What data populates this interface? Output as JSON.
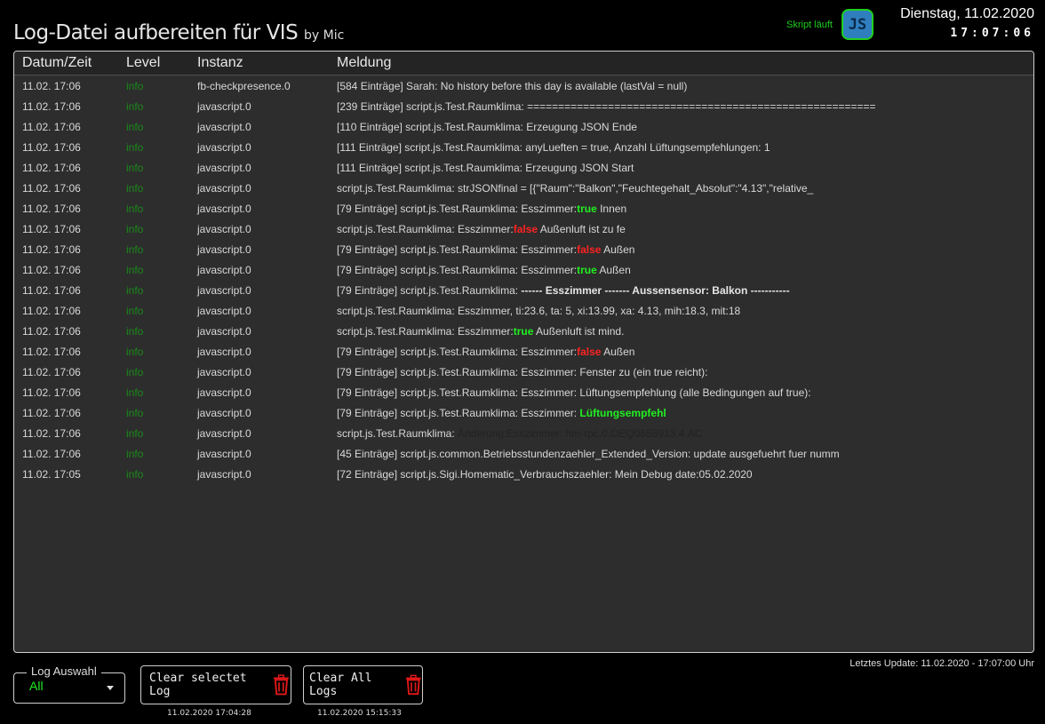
{
  "header": {
    "title": "Log-Datei aufbereiten für VIS",
    "byline": "by Mic",
    "status": "Skript läuft",
    "js_badge": "JS",
    "date": "Dienstag, 11.02.2020",
    "time": "17:07:06"
  },
  "table": {
    "columns": [
      "Datum/Zeit",
      "Level",
      "Instanz",
      "Meldung"
    ],
    "rows": [
      {
        "datetime": "11.02. 17:06",
        "level": "info",
        "instance": "fb-checkpresence.0",
        "msg": [
          {
            "t": "[584 Einträge] Sarah: No history before this day is available (lastVal = null)"
          }
        ]
      },
      {
        "datetime": "11.02. 17:06",
        "level": "info",
        "instance": "javascript.0",
        "msg": [
          {
            "t": "[239 Einträge] script.js.Test.Raumklima: ========================================================"
          }
        ]
      },
      {
        "datetime": "11.02. 17:06",
        "level": "info",
        "instance": "javascript.0",
        "msg": [
          {
            "t": "[110 Einträge] script.js.Test.Raumklima: Erzeugung JSON Ende"
          }
        ]
      },
      {
        "datetime": "11.02. 17:06",
        "level": "info",
        "instance": "javascript.0",
        "msg": [
          {
            "t": "[111 Einträge] script.js.Test.Raumklima: anyLueften = true, Anzahl Lüftungsempfehlungen: 1"
          }
        ]
      },
      {
        "datetime": "11.02. 17:06",
        "level": "info",
        "instance": "javascript.0",
        "msg": [
          {
            "t": "[111 Einträge] script.js.Test.Raumklima: Erzeugung JSON Start"
          }
        ]
      },
      {
        "datetime": "11.02. 17:06",
        "level": "info",
        "instance": "javascript.0",
        "msg": [
          {
            "t": "script.js.Test.Raumklima: strJSONfinal = [{\"Raum\":\"Balkon\",\"Feuchtegehalt_Absolut\":\"4.13\",\"relative_"
          }
        ]
      },
      {
        "datetime": "11.02. 17:06",
        "level": "info",
        "instance": "javascript.0",
        "msg": [
          {
            "t": "[79 Einträge] script.js.Test.Raumklima: Esszimmer:"
          },
          {
            "t": "true",
            "s": "t"
          },
          {
            "t": " Innen"
          }
        ]
      },
      {
        "datetime": "11.02. 17:06",
        "level": "info",
        "instance": "javascript.0",
        "msg": [
          {
            "t": "script.js.Test.Raumklima: Esszimmer:"
          },
          {
            "t": "false",
            "s": "f"
          },
          {
            "t": " Außenluft ist zu fe"
          }
        ]
      },
      {
        "datetime": "11.02. 17:06",
        "level": "info",
        "instance": "javascript.0",
        "msg": [
          {
            "t": "[79 Einträge] script.js.Test.Raumklima: Esszimmer:"
          },
          {
            "t": "false",
            "s": "f"
          },
          {
            "t": " Außen"
          }
        ]
      },
      {
        "datetime": "11.02. 17:06",
        "level": "info",
        "instance": "javascript.0",
        "msg": [
          {
            "t": "[79 Einträge] script.js.Test.Raumklima: Esszimmer:"
          },
          {
            "t": "true",
            "s": "t"
          },
          {
            "t": " Außen"
          }
        ]
      },
      {
        "datetime": "11.02. 17:06",
        "level": "info",
        "instance": "javascript.0",
        "msg": [
          {
            "t": "[79 Einträge] script.js.Test.Raumklima: "
          },
          {
            "t": "------ Esszimmer ------- Aussensensor: Balkon -----------",
            "s": "b"
          }
        ]
      },
      {
        "datetime": "11.02. 17:06",
        "level": "info",
        "instance": "javascript.0",
        "msg": [
          {
            "t": "script.js.Test.Raumklima: Esszimmer, ti:23.6, ta: 5, xi:13.99, xa: 4.13, mih:18.3, mit:18"
          }
        ]
      },
      {
        "datetime": "11.02. 17:06",
        "level": "info",
        "instance": "javascript.0",
        "msg": [
          {
            "t": "script.js.Test.Raumklima: Esszimmer:"
          },
          {
            "t": "true",
            "s": "t"
          },
          {
            "t": " Außenluft ist mind."
          }
        ]
      },
      {
        "datetime": "11.02. 17:06",
        "level": "info",
        "instance": "javascript.0",
        "msg": [
          {
            "t": "[79 Einträge] script.js.Test.Raumklima: Esszimmer:"
          },
          {
            "t": "false",
            "s": "f"
          },
          {
            "t": " Außen"
          }
        ]
      },
      {
        "datetime": "11.02. 17:06",
        "level": "info",
        "instance": "javascript.0",
        "msg": [
          {
            "t": "[79 Einträge] script.js.Test.Raumklima: Esszimmer: Fenster zu (ein true reicht):"
          }
        ]
      },
      {
        "datetime": "11.02. 17:06",
        "level": "info",
        "instance": "javascript.0",
        "msg": [
          {
            "t": "[79 Einträge] script.js.Test.Raumklima: Esszimmer: Lüftungsempfehlung (alle Bedingungen auf true):"
          }
        ]
      },
      {
        "datetime": "11.02. 17:06",
        "level": "info",
        "instance": "javascript.0",
        "msg": [
          {
            "t": "[79 Einträge] script.js.Test.Raumklima: Esszimmer: "
          },
          {
            "t": "Lüftungsempfehl",
            "s": "g"
          }
        ]
      },
      {
        "datetime": "11.02. 17:06",
        "level": "info",
        "instance": "javascript.0",
        "msg": [
          {
            "t": "script.js.Test.Raumklima: "
          },
          {
            "t": "Änderung:Esszimmer: hm-rpc.0.OEQ0655913.4.AC",
            "s": "dim"
          }
        ]
      },
      {
        "datetime": "11.02. 17:06",
        "level": "info",
        "instance": "javascript.0",
        "msg": [
          {
            "t": "[45 Einträge] script.js.common.Betriebsstundenzaehler_Extended_Version: update ausgefuehrt fuer numm"
          }
        ]
      },
      {
        "datetime": "11.02. 17:05",
        "level": "info",
        "instance": "javascript.0",
        "msg": [
          {
            "t": "[72 Einträge] script.js.Sigi.Homematic_Verbrauchszaehler: Mein Debug date:05.02.2020"
          }
        ]
      }
    ]
  },
  "footer": {
    "log_select_label": "Log Auswahl",
    "log_select_value": "All",
    "clear_selected_label": "Clear selectet Log",
    "clear_selected_ts": "11.02.2020 17:04:28",
    "clear_all_label": "Clear All Logs",
    "clear_all_ts": "11.02.2020 15:15:33",
    "last_update": "Letztes Update: 11.02.2020 - 17:07:00 Uhr"
  },
  "icons": {
    "trash": "trash-icon",
    "caret": "chevron-down-icon"
  },
  "colors": {
    "accent_green": "#22ee22",
    "false_red": "#ff2222",
    "trash_red": "#e01818",
    "badge_blue": "#2f7fbf"
  }
}
